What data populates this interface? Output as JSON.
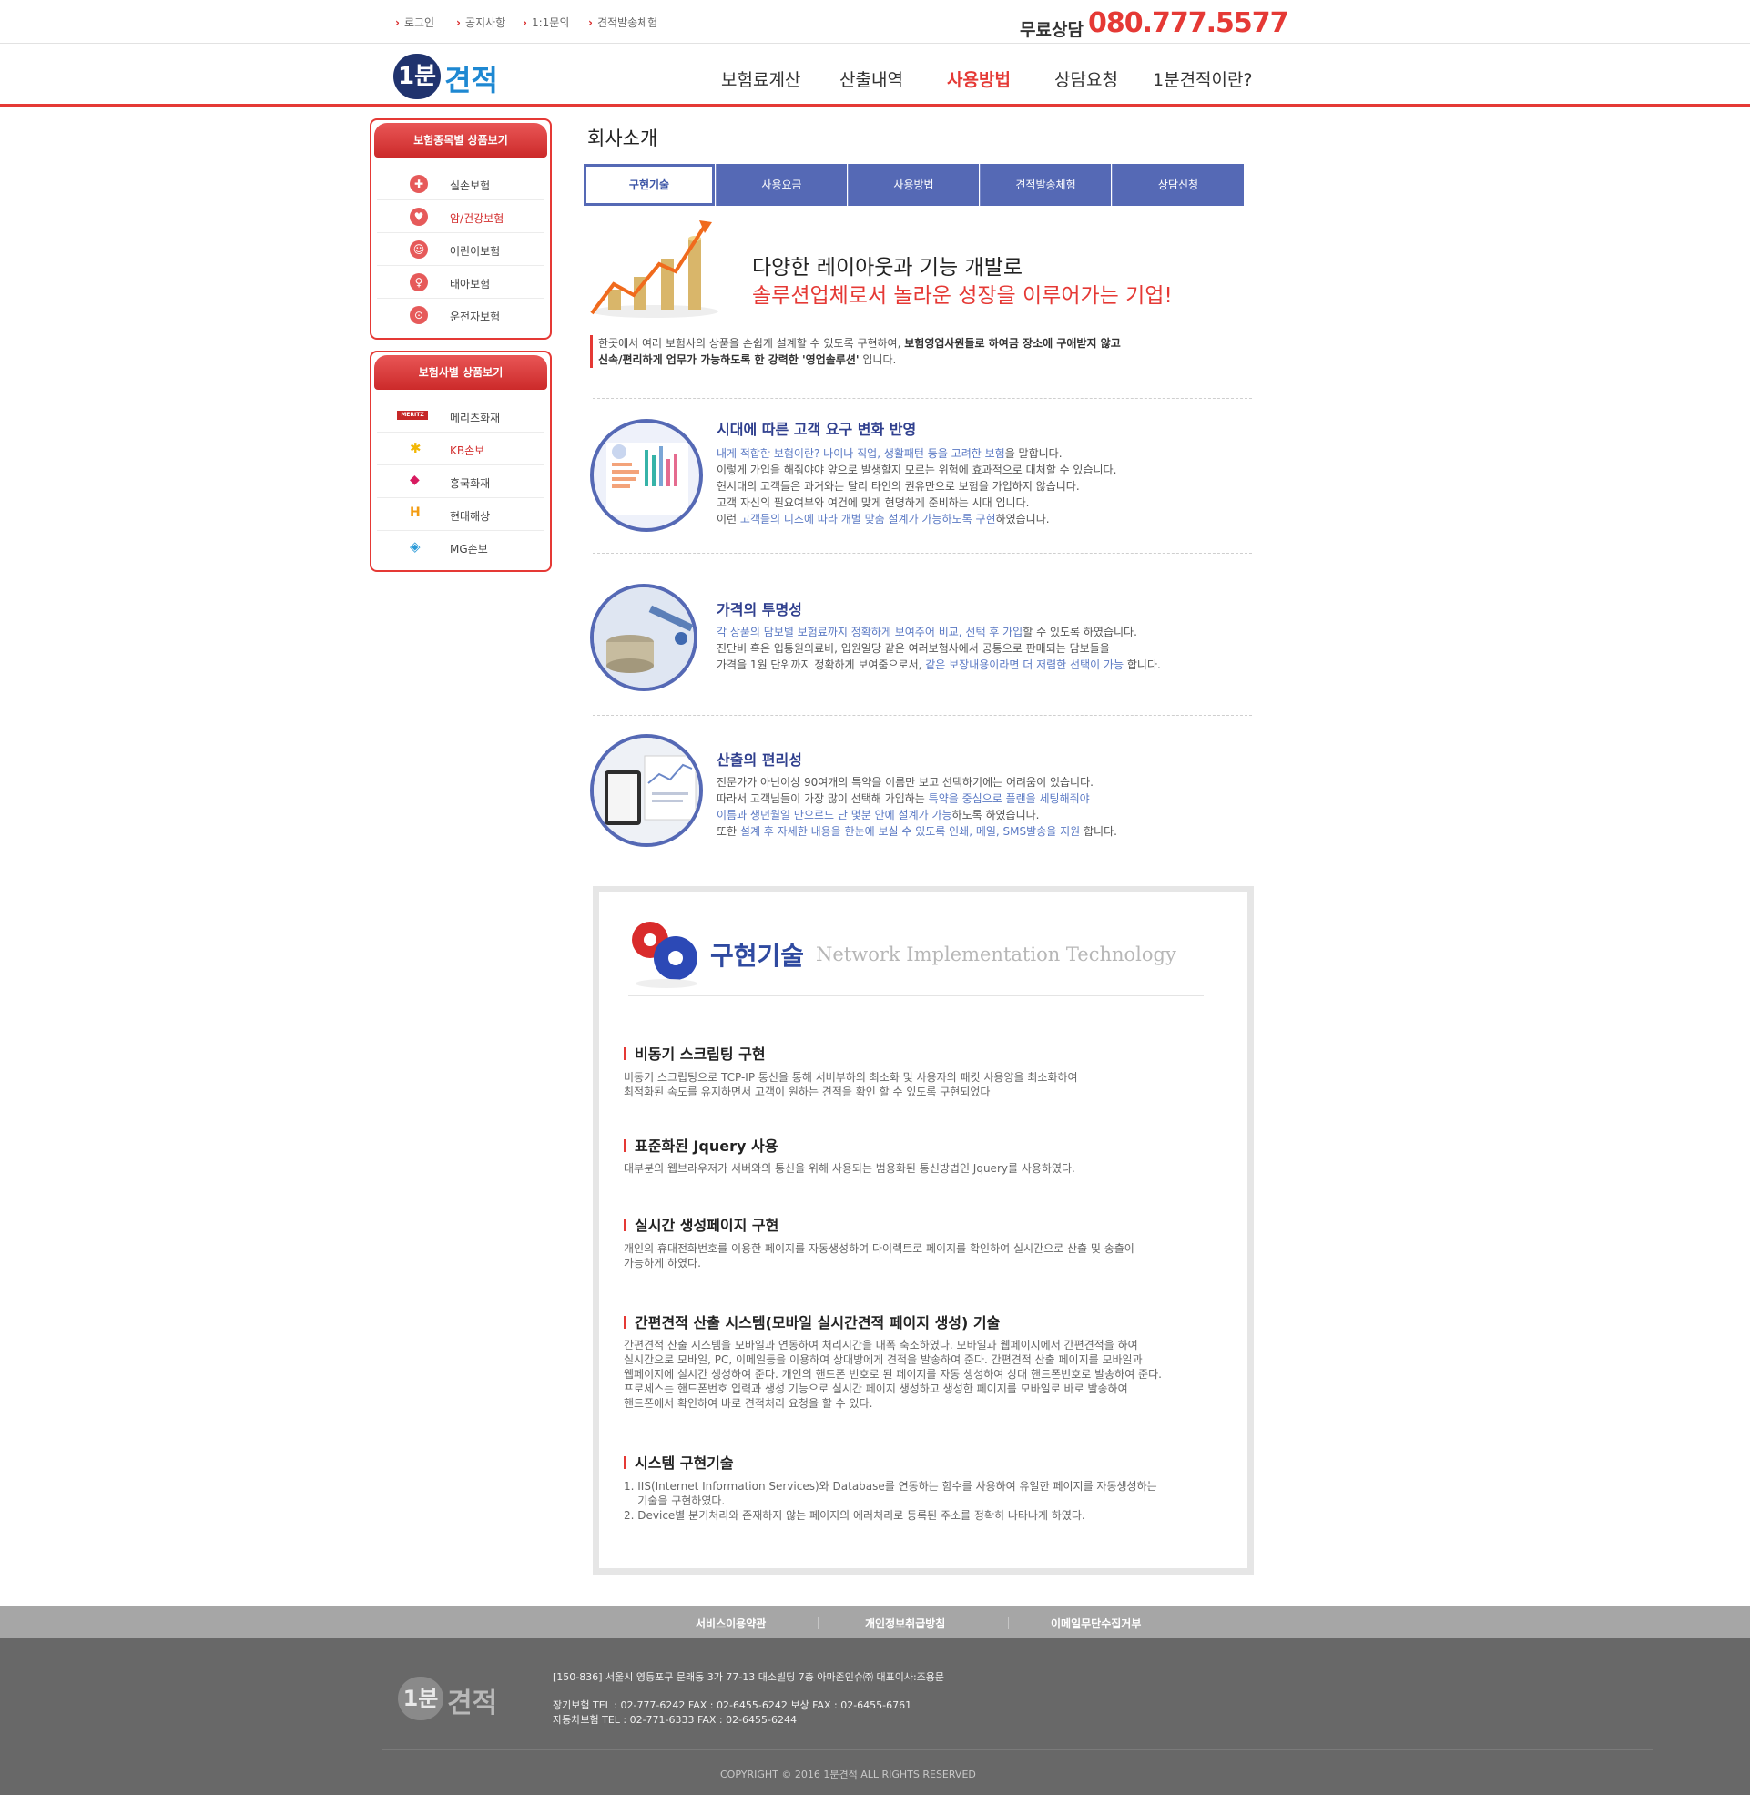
{
  "colors": {
    "accent": "#e53935",
    "brand_blue": "#5569b5",
    "navy": "#20336e",
    "footer_bg": "#686868"
  },
  "top_links": [
    "로그인",
    "공지사항",
    "1:1문의",
    "견적발송체험"
  ],
  "consult": {
    "label": "무료상담",
    "phone": "080.777.5577"
  },
  "logo": {
    "num": "1분",
    "word": "견적"
  },
  "main_nav": [
    "보험료계산",
    "산출내역",
    "사용방법",
    "상담요청",
    "1분견적이란?"
  ],
  "sidebar": {
    "product_box": {
      "title": "보험종목별 상품보기",
      "items": [
        {
          "label": "실손보험",
          "icon": "medical-icon"
        },
        {
          "label": "암/건강보험",
          "icon": "heart-icon"
        },
        {
          "label": "어린이보험",
          "icon": "child-icon"
        },
        {
          "label": "태아보험",
          "icon": "baby-icon"
        },
        {
          "label": "운전자보험",
          "icon": "car-icon"
        }
      ]
    },
    "company_box": {
      "title": "보험사별 상품보기",
      "items": [
        {
          "label": "메리츠화재",
          "icon": "meritz-logo"
        },
        {
          "label": "KB손보",
          "icon": "kb-logo"
        },
        {
          "label": "흥국화재",
          "icon": "heungkuk-logo"
        },
        {
          "label": "현대해상",
          "icon": "hyundai-logo"
        },
        {
          "label": "MG손보",
          "icon": "mg-logo"
        }
      ]
    }
  },
  "page_title": "회사소개",
  "tabs": [
    "구현기술",
    "사용요금",
    "사용방법",
    "견적발송체험",
    "상담신청"
  ],
  "intro": {
    "h1": "다양한 레이아웃과 기능 개발로",
    "h2": "솔루션업체로서 놀라운 성장을 이루어가는 기업!",
    "line1_a": "한곳에서 여러 보험사의 상품을 손쉽게 설계할 수 있도록 구현하여, ",
    "line1_b": "보험영업사원들로 하여금 장소에 구애받지 않고",
    "line2": "신속/편리하게 업무가 가능하도록 한 강력한 '영업솔루션'",
    "line2_end": " 입니다."
  },
  "features": [
    {
      "title": "시대에 따른 고객 요구 변화 반영",
      "lines": [
        {
          "hl": "내게 적합한 보험이란? 나이나 직업, 생활패턴 등을 고려한 보험",
          "rest": "을 말합니다."
        },
        {
          "pre": "이렇게 가입을 해줘야야 앞으로 발생할지 모르는 위험에 효과적으로 대처할 수 있습니다."
        },
        {
          "pre": "현시대의 고객들은 과거와는 달리 타인의 권유만으로 보험을 가입하지 않습니다."
        },
        {
          "pre": "고객 자신의 필요여부와 여건에 맞게 현명하게 준비하는 시대 입니다."
        },
        {
          "pre": "이런 ",
          "hl": "고객들의 니즈에 따라 개별 맞춤 설계가 가능하도록 구현",
          "rest": "하였습니다."
        }
      ]
    },
    {
      "title": "가격의 투명성",
      "lines": [
        {
          "hl": "각 상품의 담보별 보험료까지 정확하게 보여주어 비교, 선택 후 가입",
          "rest": "할 수 있도록 하였습니다."
        },
        {
          "pre": "진단비 혹은 입통원의료비, 입원일당 같은 여러보험사에서 공통으로 판매되는 담보들을"
        },
        {
          "pre": "가격을 1원 단위까지 정확하게 보여줌으로서, ",
          "hl": "같은 보장내용이라면 더 저렴한 선택이 가능",
          "rest": " 합니다."
        }
      ]
    },
    {
      "title": "산출의 편리성",
      "lines": [
        {
          "pre": "전문가가 아닌이상 90여개의 특약을 이름만 보고 선택하기에는 어려움이 있습니다."
        },
        {
          "pre": "따라서 고객님들이 가장 많이 선택해 가입하는 ",
          "hl": "특약을 중심으로 플랜을 세팅해줘야"
        },
        {
          "hl": "이름과 생년월일 만으로도 단 몇분 안에 설계가 가능",
          "rest": "하도록 하였습니다."
        },
        {
          "pre": "또한 ",
          "hl": "설계 후 자세한 내용을 한눈에 보실 수 있도록 인쇄, 메일, SMS발송을 지원",
          "rest": " 합니다."
        }
      ]
    }
  ],
  "tech": {
    "title": "구현기술",
    "subtitle": "Network Implementation Technology",
    "sections": [
      {
        "title": "비동기 스크립팅 구현",
        "lines": [
          "비동기 스크립팅으로 TCP-IP 통신을 통해 서버부하의 최소화 및 사용자의 패킷 사용양을 최소화하여",
          "최적화된 속도를 유지하면서 고객이 원하는 견적을 확인 할 수 있도록 구현되었다"
        ]
      },
      {
        "title": "표준화된 Jquery 사용",
        "lines": [
          "대부분의 웹브라우저가 서버와의 통신을 위해 사용되는 범용화된 통신방법인 Jquery를 사용하였다."
        ]
      },
      {
        "title": "실시간 생성페이지 구현",
        "lines": [
          "개인의 휴대전화번호를 이용한 페이지를 자동생성하여 다이렉트로 페이지를 확인하여 실시간으로 산출 및 송출이",
          "가능하게 하였다."
        ]
      },
      {
        "title": "간편견적 산출 시스템(모바일 실시간견적 페이지 생성) 기술",
        "lines": [
          "간편견적 산출 시스템을 모바일과 연동하여 처리시간을 대폭 축소하였다. 모바일과 웹페이지에서 간편견적을 하여",
          "실시간으로 모바일, PC, 이메일등을 이용하여 상대방에게 견적을 발송하여 준다. 간편견적 산출 페이지를 모바일과",
          "웹페이지에 실시간 생성하여 준다. 개인의 핸드폰 번호로 된 페이지를 자동 생성하여 상대 핸드폰번호로 발송하여 준다.",
          "프로세스는 핸드폰번호 입력과 생성 기능으로 실시간 페이지 생성하고 생성한 페이지를 모바일로 바로 발송하여",
          "핸드폰에서 확인하여 바로 견적처리 요청을 할 수 있다."
        ]
      },
      {
        "title": "시스템 구현기술",
        "lines": [
          "1. IIS(Internet Information Services)와 Database를 연동하는 함수를 사용하여 유일한 페이지를 자동생성하는",
          "    기술을 구현하였다.",
          "2. Device별 분기처리와 존재하지 않는 페이지의 에러처리로 등록된 주소를 정확히 나타나게 하였다."
        ]
      }
    ]
  },
  "footer": {
    "links": [
      "서비스이용약관",
      "개인정보취급방침",
      "이메일무단수집거부"
    ],
    "logo": {
      "num": "1분",
      "word": "견적"
    },
    "address": "[150-836] 서울시 영등포구 문래동 3가 77-13 대소빌딩 7층 아마존인슈㈜ 대표이사:조용문",
    "tel1": "장기보험 TEL : 02-777-6242 FAX : 02-6455-6242 보상 FAX : 02-6455-6761",
    "tel2": "자동차보험 TEL : 02-771-6333 FAX : 02-6455-6244",
    "copyright": "COPYRIGHT © 2016 1분견적 ALL RIGHTS RESERVED"
  }
}
